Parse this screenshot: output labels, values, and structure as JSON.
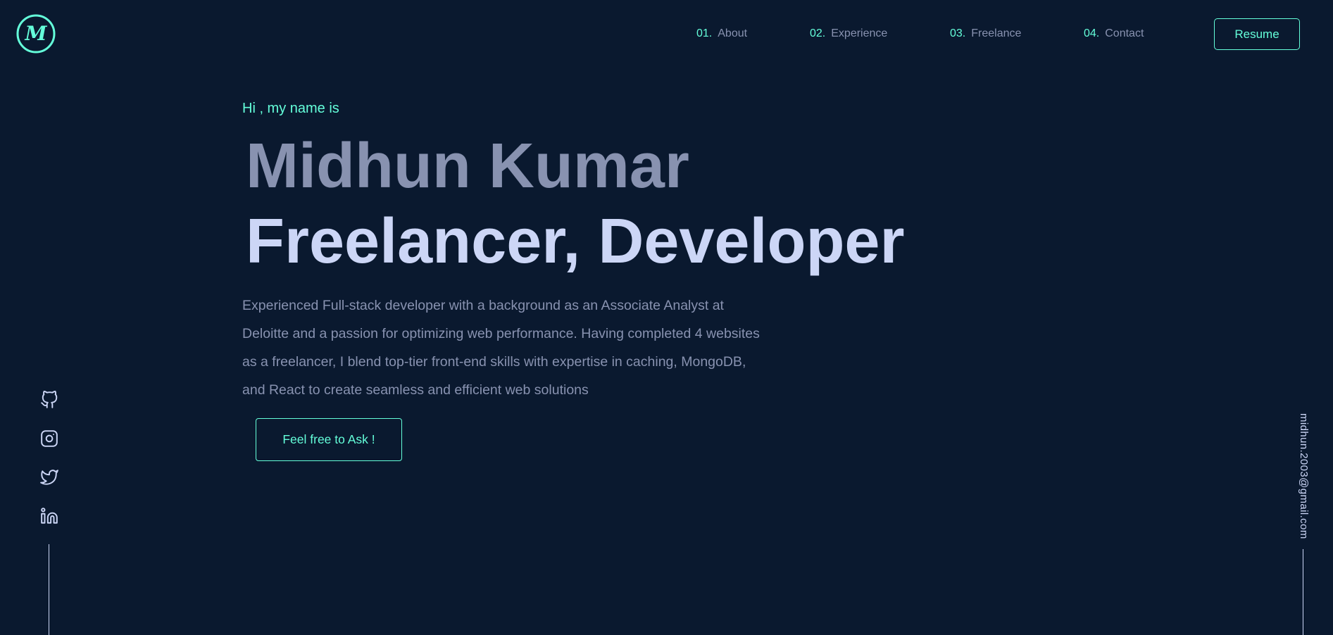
{
  "logo": {
    "letter": "M",
    "color": "#64ffda"
  },
  "nav": {
    "items": [
      {
        "number": "01.",
        "label": "About"
      },
      {
        "number": "02.",
        "label": "Experience"
      },
      {
        "number": "03.",
        "label": "Freelance"
      },
      {
        "number": "04.",
        "label": "Contact"
      }
    ],
    "resume_label": "Resume"
  },
  "hero": {
    "greeting": "Hi , my name is",
    "name": "Midhun Kumar",
    "role": "Freelancer, Developer",
    "description": "Experienced Full-stack developer with a background as an Associate Analyst at Deloitte and a passion for optimizing web performance. Having completed 4 websites as a freelancer, I blend top-tier front-end skills with expertise in caching, MongoDB, and React to create seamless and efficient web solutions",
    "cta_label": "Feel free to Ask !"
  },
  "social": {
    "icons": [
      "github-icon",
      "instagram-icon",
      "twitter-icon",
      "linkedin-icon"
    ]
  },
  "email": "midhun.2003@gmail.com",
  "colors": {
    "background": "#0a192f",
    "accent": "#64ffda",
    "text_muted": "#8892b0",
    "text_light": "#ccd6f6"
  }
}
